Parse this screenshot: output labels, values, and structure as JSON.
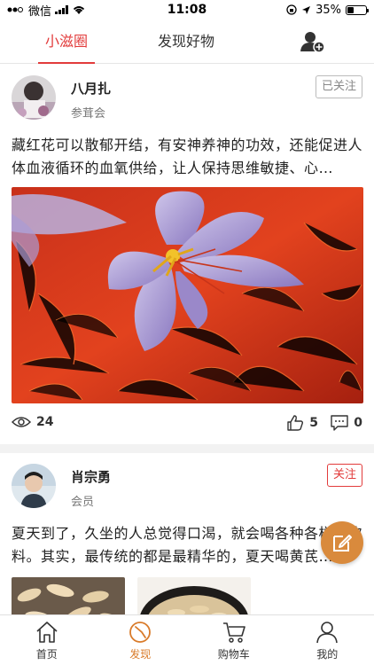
{
  "status_bar": {
    "carrier": "微信",
    "time": "11:08",
    "battery_text": "35%",
    "battery_level": 0.35
  },
  "top_tabs": {
    "tab1": "小滋圈",
    "tab2": "发现好物",
    "active_color": "#e23b3b",
    "add_friend_icon": "add-user-icon"
  },
  "posts": [
    {
      "author": "八月扎",
      "group": "参茸会",
      "follow_label": "已关注",
      "text": "藏红花可以散郁开结，有安神养神的功效，还能促进人体血液循环的血氧供给，让人保持思维敏捷、心…",
      "views": "24",
      "likes": "5",
      "comments": "0"
    },
    {
      "author": "肖宗勇",
      "group": "会员",
      "follow_label": "关注",
      "text": "夏天到了，久坐的人总觉得口渴，就会喝各种各样的饮料。其实，最传统的都是最精华的，夏天喝黄芪…"
    }
  ],
  "fab": {
    "icon": "edit-icon",
    "color": "#d98a3c"
  },
  "bottom_nav": {
    "home": "首页",
    "discover": "发现",
    "cart": "购物车",
    "mine": "我的",
    "active_color": "#d97b2a"
  }
}
